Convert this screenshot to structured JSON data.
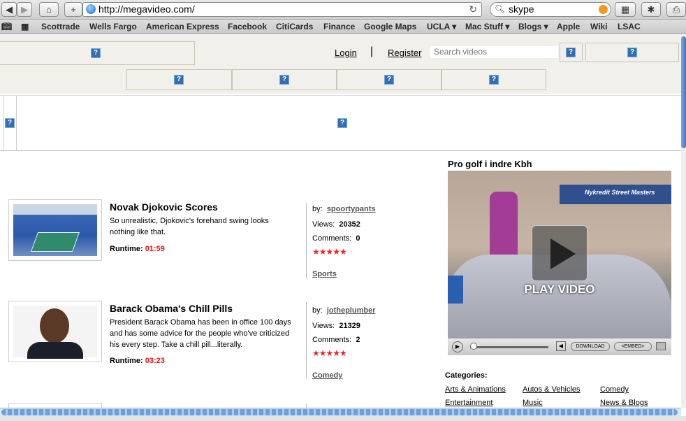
{
  "browser": {
    "url": "http://megavideo.com/",
    "search_query": "skype",
    "bookmarks": [
      "Scottrade",
      "Wells Fargo",
      "American Express",
      "Facebook",
      "CitiCards",
      "Finance",
      "Google Maps",
      "UCLA ▾",
      "Mac Stuff ▾",
      "Blogs ▾",
      "Apple",
      "Wiki",
      "LSAC"
    ]
  },
  "header": {
    "login": "Login",
    "register": "Register",
    "search_placeholder": "Search videos",
    "separator": "|"
  },
  "videos": [
    {
      "title": "Novak Djokovic Scores",
      "description": "So unrealistic, Djokovic's forehand swing looks nothing like that.",
      "runtime_label": "Runtime:",
      "runtime": "01:59",
      "by_label": "by:",
      "user": "spoortypants",
      "views_label": "Views:",
      "views": "20352",
      "comments_label": "Comments:",
      "comments": "0",
      "stars": "★★★★★",
      "category": "Sports"
    },
    {
      "title": "Barack Obama's Chill Pills",
      "description": "President Barack Obama has been in office 100 days and has some advice for the people who've criticized his every step. Take a chill pill...literally.",
      "runtime_label": "Runtime:",
      "runtime": "03:23",
      "by_label": "by:",
      "user": "jotheplumber",
      "views_label": "Views:",
      "views": "21329",
      "comments_label": "Comments:",
      "comments": "2",
      "stars": "★★★★★",
      "category": "Comedy"
    }
  ],
  "featured": {
    "title": "Pro golf i indre Kbh",
    "play_label": "PLAY VIDEO",
    "sign_text": "Nykredit Street Masters",
    "download_label": "DOWNLOAD",
    "embed_label": "<EMBED>"
  },
  "categories": {
    "heading": "Categories:",
    "items": [
      "Arts & Animations",
      "Autos & Vehicles",
      "Comedy",
      "Entertainment",
      "Music",
      "News & Blogs"
    ]
  },
  "colors": {
    "header_bg": "#f2f0ea",
    "runtime_red": "#e11111",
    "star_red": "#e22222",
    "placeholder_icon": "#2f6fb8"
  }
}
